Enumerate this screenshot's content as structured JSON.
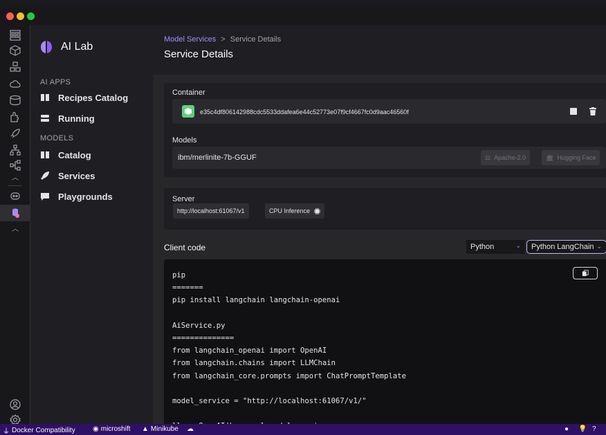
{
  "app": {
    "name": "AI Lab"
  },
  "sidebar": {
    "sections": [
      {
        "label": "AI APPS"
      },
      {
        "label": "MODELS"
      }
    ],
    "items": [
      {
        "label": "Recipes Catalog",
        "icon": "book-icon"
      },
      {
        "label": "Running",
        "icon": "server-icon"
      },
      {
        "label": "Catalog",
        "icon": "book-icon"
      },
      {
        "label": "Services",
        "icon": "rocket-icon"
      },
      {
        "label": "Playgrounds",
        "icon": "chat-icon"
      }
    ]
  },
  "header": {
    "breadcrumb_link": "Model Services",
    "breadcrumb_sep": ">",
    "breadcrumb_current": "Service Details",
    "title": "Service Details"
  },
  "container": {
    "label": "Container",
    "id": "e35c4df806142988cdc5533ddafea6e44c52773e07f9cf4667fc0d9aac46560f"
  },
  "models": {
    "label": "Models",
    "name": "ibm/merlinite-7b-GGUF",
    "license": "Apache-2.0",
    "registry": "Hugging Face"
  },
  "server": {
    "label": "Server",
    "url": "http://localhost:61067/v1",
    "inference": "CPU Inference"
  },
  "client": {
    "label": "Client code",
    "language": "Python",
    "framework": "Python LangChain",
    "code_lines": [
      "pip",
      "=======",
      "pip install langchain langchain-openai",
      "",
      "AiService.py",
      "==============",
      "from langchain_openai import OpenAI",
      "from langchain.chains import LLMChain",
      "from langchain_core.prompts import ChatPromptTemplate",
      "",
      "model_service = \"http://localhost:61067/v1/\"",
      "",
      "llm = OpenAI(base_url=model_service,"
    ]
  },
  "statusbar": {
    "items": [
      {
        "label": "Docker Compatibility"
      },
      {
        "label": "microshift"
      },
      {
        "label": "Minikube"
      }
    ]
  },
  "colors": {
    "accent": "#a78bfa",
    "statusbar": "#2e1065",
    "container_icon": "#5ed17b"
  }
}
